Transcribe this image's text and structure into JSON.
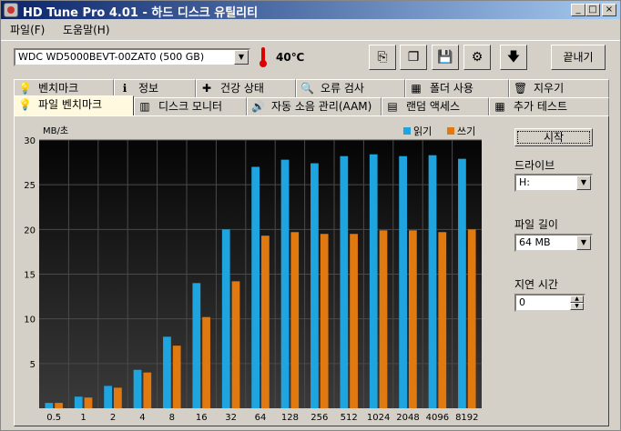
{
  "window": {
    "title": "HD Tune Pro 4.01 - 하드 디스크 유틸리티"
  },
  "title_buttons": {
    "minimize": "_",
    "maximize": "□",
    "close": "×"
  },
  "menu": {
    "items": [
      "파일(F)",
      "도움말(H)"
    ]
  },
  "toolbar": {
    "drive": "WDC WD5000BEVT-00ZAT0   (500 GB)",
    "temperature": "40℃",
    "icons": [
      "copy-info-icon",
      "copy-screenshot-icon",
      "save-icon",
      "options-icon",
      "download-icon"
    ],
    "icon_glyphs": [
      "⎘",
      "❐",
      "💾",
      "⚙",
      "🡇"
    ],
    "exit_label": "끝내기"
  },
  "tabs_row1": [
    {
      "label": "벤치마크",
      "icon": "benchmark-icon",
      "glyph": "💡"
    },
    {
      "label": "정보",
      "icon": "info-icon",
      "glyph": "ℹ"
    },
    {
      "label": "건강 상태",
      "icon": "health-icon",
      "glyph": "✚"
    },
    {
      "label": "오류 검사",
      "icon": "error-scan-icon",
      "glyph": "🔍"
    },
    {
      "label": "폴더 사용",
      "icon": "folder-usage-icon",
      "glyph": "▦"
    },
    {
      "label": "지우기",
      "icon": "erase-icon",
      "glyph": "🗑"
    }
  ],
  "tabs_row2": [
    {
      "label": "파일 벤치마크",
      "icon": "file-benchmark-icon",
      "glyph": "💡",
      "active": true
    },
    {
      "label": "디스크 모니터",
      "icon": "disk-monitor-icon",
      "glyph": "▥"
    },
    {
      "label": "자동 소음 관리(AAM)",
      "icon": "speaker-icon",
      "glyph": "🔊"
    },
    {
      "label": "랜덤 액세스",
      "icon": "random-access-icon",
      "glyph": "▤"
    },
    {
      "label": "추가 테스트",
      "icon": "extra-tests-icon",
      "glyph": "▦"
    }
  ],
  "side": {
    "start_label": "시작",
    "drive_label": "드라이브",
    "drive_value": "H:",
    "file_length_label": "파일 길이",
    "file_length_value": "64 MB",
    "delay_label": "지연 시간",
    "delay_value": "0"
  },
  "colors": {
    "read": "#1ea5e0",
    "write": "#e07a10",
    "chart_bg": "#0c0c0c",
    "grid": "#4a4a4a"
  },
  "chart_data": {
    "type": "bar",
    "ylabel": "MB/초",
    "ylim": [
      0,
      30
    ],
    "yticks": [
      5,
      10,
      15,
      20,
      25,
      30
    ],
    "categories": [
      "0.5",
      "1",
      "2",
      "4",
      "8",
      "16",
      "32",
      "64",
      "128",
      "256",
      "512",
      "1024",
      "2048",
      "4096",
      "8192"
    ],
    "series": [
      {
        "name": "읽기",
        "values": [
          0.6,
          1.3,
          2.5,
          4.3,
          8.0,
          14.0,
          20.0,
          27.0,
          27.8,
          27.4,
          28.2,
          28.4,
          28.2,
          28.3,
          27.9
        ]
      },
      {
        "name": "쓰기",
        "values": [
          0.6,
          1.2,
          2.3,
          4.0,
          7.0,
          10.2,
          14.2,
          19.3,
          19.7,
          19.5,
          19.5,
          19.9,
          19.9,
          19.7,
          20.0
        ]
      }
    ],
    "legend": "top-right",
    "grid": true
  }
}
